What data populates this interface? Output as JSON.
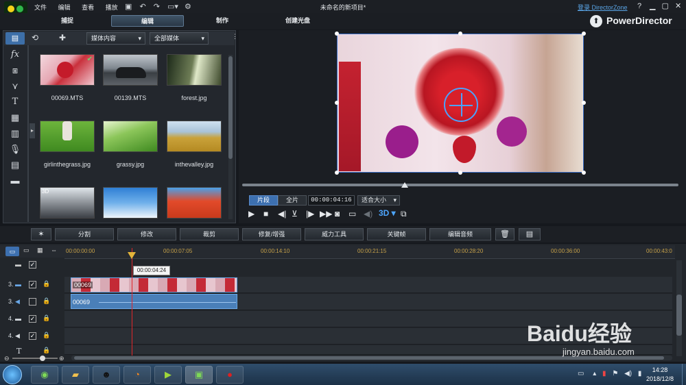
{
  "window": {
    "title": "未命名的新项目*",
    "menu": [
      "文件",
      "编辑",
      "查看",
      "播放"
    ],
    "login_link": "登录 DirectorZone",
    "help": "?",
    "brand": "PowerDirector"
  },
  "tabs": [
    "捕捉",
    "编辑",
    "制作",
    "创建光盘"
  ],
  "library": {
    "dropdown1": "媒体内容",
    "dropdown2": "全部媒体",
    "items": [
      {
        "name": "00069.MTS"
      },
      {
        "name": "00139.MTS"
      },
      {
        "name": "forest.jpg"
      },
      {
        "name": "girlinthegrass.jpg"
      },
      {
        "name": "grassy.jpg"
      },
      {
        "name": "inthevalley.jpg"
      }
    ],
    "tool_icons": [
      "fx-icon",
      "transition-icon",
      "particle-icon",
      "title-icon",
      "pip-icon",
      "audio-mix-icon",
      "voice-icon",
      "chapter-icon",
      "subtitle-icon"
    ]
  },
  "preview": {
    "mode_clip": "片段",
    "mode_movie": "全片",
    "timecode": "00:00:04:16",
    "fit": "适合大小",
    "threed": "3D"
  },
  "edit_toolbar": [
    "分割",
    "修改",
    "裁剪",
    "修复/增强",
    "威力工具",
    "关键帧",
    "编辑音频"
  ],
  "ruler": {
    "marks": [
      "00:00:00:00",
      "00:00:07:05",
      "00:00:14:10",
      "00:00:21:15",
      "00:00:28:20",
      "00:00:36:00",
      "00:00:43:0"
    ],
    "tooltip": "00:00:04:24"
  },
  "tracks": [
    {
      "label": "3.",
      "kind": "video-icon",
      "clip": "00069"
    },
    {
      "label": "3.",
      "kind": "audio-icon",
      "clip": "00069"
    },
    {
      "label": "4.",
      "kind": "video-icon",
      "clip": ""
    },
    {
      "label": "4.",
      "kind": "audio-icon",
      "clip": ""
    },
    {
      "label": "T",
      "kind": "title-icon",
      "clip": ""
    }
  ],
  "taskbar": {
    "time": "14:28",
    "date": "2018/12/8"
  },
  "watermark": {
    "brand": "Baidu经验",
    "url": "jingyan.baidu.com"
  }
}
